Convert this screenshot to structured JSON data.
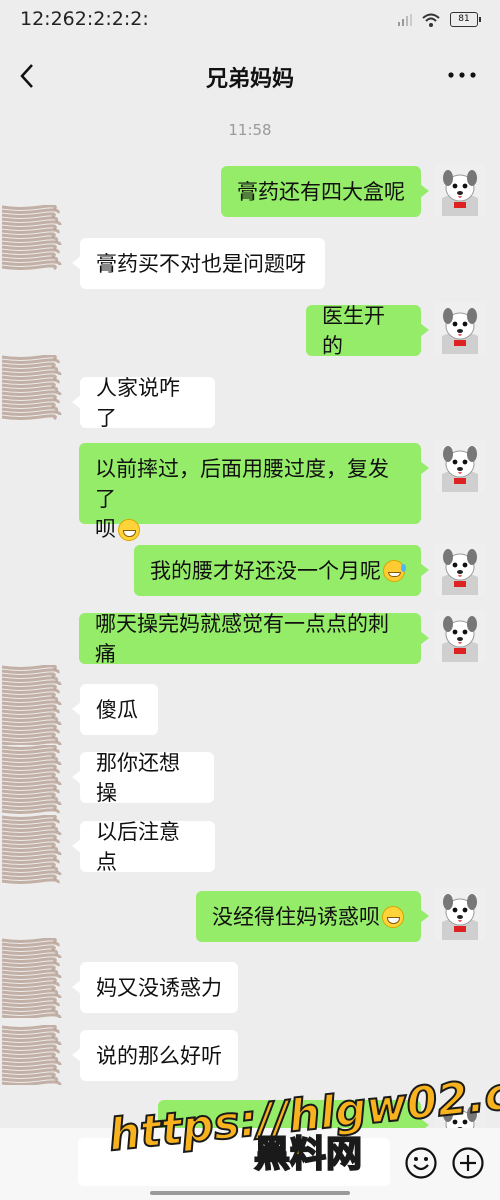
{
  "status": {
    "time": "12:262:2:2:2:",
    "battery": "81"
  },
  "header": {
    "title": "兄弟妈妈"
  },
  "timestamp": "11:58",
  "messages": [
    {
      "side": "out",
      "text": "膏药还有四大盒呢"
    },
    {
      "side": "in",
      "text": "膏药买不对也是问题呀"
    },
    {
      "side": "out",
      "text": "医生开的"
    },
    {
      "side": "in",
      "text": "人家说咋了"
    },
    {
      "side": "out",
      "line1": "以前摔过，后面用腰过度，复发了",
      "line2": "呗",
      "emoji": "grin-emoji"
    },
    {
      "side": "out",
      "text": "我的腰才好还没一个月呢",
      "emoji": "laugh-cry-emoji"
    },
    {
      "side": "out",
      "text": "哪天操完妈就感觉有一点点的刺痛"
    },
    {
      "side": "in",
      "text": "傻瓜"
    },
    {
      "side": "in",
      "text": "那你还想操"
    },
    {
      "side": "in",
      "text": "以后注意点"
    },
    {
      "side": "out",
      "text": "没经得住妈诱惑呗",
      "emoji": "grin-emoji"
    },
    {
      "side": "in",
      "text": "妈又没诱惑力"
    },
    {
      "side": "in",
      "text": "说的那么好听"
    }
  ],
  "watermark": {
    "url": "https://hlgw02.com",
    "name": "黑料网"
  },
  "colors": {
    "outgoing_bubble": "#95ec69",
    "incoming_bubble": "#ffffff",
    "background": "#ededed"
  }
}
